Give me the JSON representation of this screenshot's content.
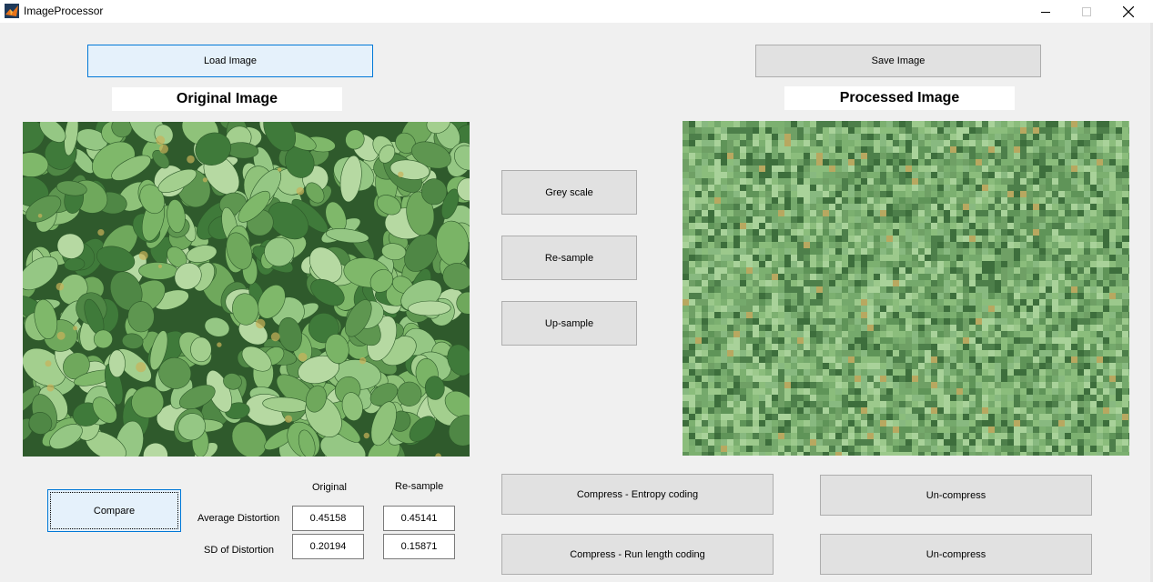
{
  "window": {
    "title": "ImageProcessor"
  },
  "left_panel": {
    "load_button": "Load Image",
    "image_title": "Original Image",
    "image_icon": "leaves-photo-icon"
  },
  "right_panel": {
    "save_button": "Save Image",
    "image_title": "Processed Image",
    "image_icon": "leaves-photo-pixelated-icon"
  },
  "operations": {
    "grey_scale": "Grey scale",
    "resample": "Re-sample",
    "upsample": "Up-sample"
  },
  "compression": {
    "entropy_coding": "Compress - Entropy coding",
    "run_length_coding": "Compress - Run length coding",
    "uncompress_1": "Un-compress",
    "uncompress_2": "Un-compress"
  },
  "stats": {
    "compare_button": "Compare",
    "col_original": "Original",
    "col_resample": "Re-sample",
    "row_avg": "Average Distortion",
    "row_sd": "SD of Distortion",
    "avg_original": "0.45158",
    "avg_resample": "0.45141",
    "sd_original": "0.20194",
    "sd_resample": "0.15871"
  },
  "colors": {
    "accent": "#0078d7",
    "button_bg": "#e1e1e1",
    "focus_bg": "#e5f1fb",
    "leaf_light": "#8fc27a",
    "leaf_dark": "#3f7a3a"
  }
}
